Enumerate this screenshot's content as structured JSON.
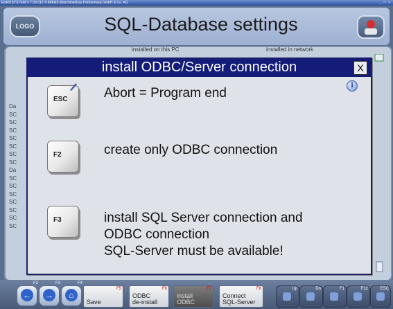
{
  "titlebar": {
    "text": "EUROSYSTEM V 7.00.012 © MIKAS Maschinenbau Hubbenweg GmbH & Co. KG",
    "controls": "_ □ ×"
  },
  "header": {
    "logo_label": "LOGO",
    "title": "SQL-Database settings",
    "corner_icon": "user-icon"
  },
  "groups": {
    "installed_pc": "installed on this PC",
    "installed_network": "installed in network"
  },
  "left_list": [
    "Da",
    "SC",
    "SC",
    "SC",
    "SC",
    "SC",
    "SC",
    "SC",
    "Da",
    "SC",
    "SC",
    "SC",
    "SC",
    "SC",
    "SC",
    "SC"
  ],
  "dialog": {
    "title": "install ODBC/Server connection",
    "close_label": "X",
    "info_icon": "info-icon",
    "options": [
      {
        "key": "ESC",
        "lines": [
          "Abort = Program end"
        ]
      },
      {
        "key": "F2",
        "lines": [
          "create only ODBC connection"
        ]
      },
      {
        "key": "F3",
        "lines": [
          "install SQL Server connection and",
          "ODBC connection",
          "SQL-Server must be available!"
        ]
      }
    ]
  },
  "toolbar": {
    "nav": [
      {
        "fk": "F2",
        "icon": "arrow-left-icon",
        "glyph": "←"
      },
      {
        "fk": "F3",
        "icon": "arrow-right-icon",
        "glyph": "→"
      },
      {
        "fk": "F4",
        "icon": "home-icon",
        "glyph": "⌂"
      }
    ],
    "buttons": [
      {
        "label": "Save",
        "fk": "F5"
      },
      {
        "label": "ODBC de-install",
        "fk": "F6"
      },
      {
        "label": "install ODBC",
        "fk": "F7"
      },
      {
        "label": "Connect SQL-Server",
        "fk": "F8"
      }
    ],
    "right": [
      {
        "fk": "Up"
      },
      {
        "fk": "Dn"
      },
      {
        "fk": "F1"
      },
      {
        "fk": "F12"
      },
      {
        "fk": "ESC"
      }
    ]
  }
}
